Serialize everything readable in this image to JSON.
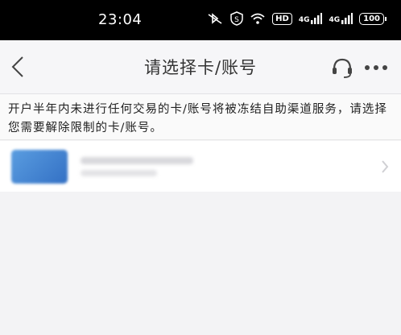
{
  "status_bar": {
    "time": "23:04",
    "hd_label": "HD",
    "network_label_1": "4G",
    "network_label_2": "4G",
    "battery": "100"
  },
  "navbar": {
    "title": "请选择卡/账号"
  },
  "notice": {
    "text": "开户半年内未进行任何交易的卡/账号将被冻结自助渠道服务，请选择您需要解除限制的卡/账号。"
  },
  "colors": {
    "status_bar_bg": "#000000",
    "page_bg": "#f3f3f5",
    "card_thumb": "#4a88d6"
  }
}
